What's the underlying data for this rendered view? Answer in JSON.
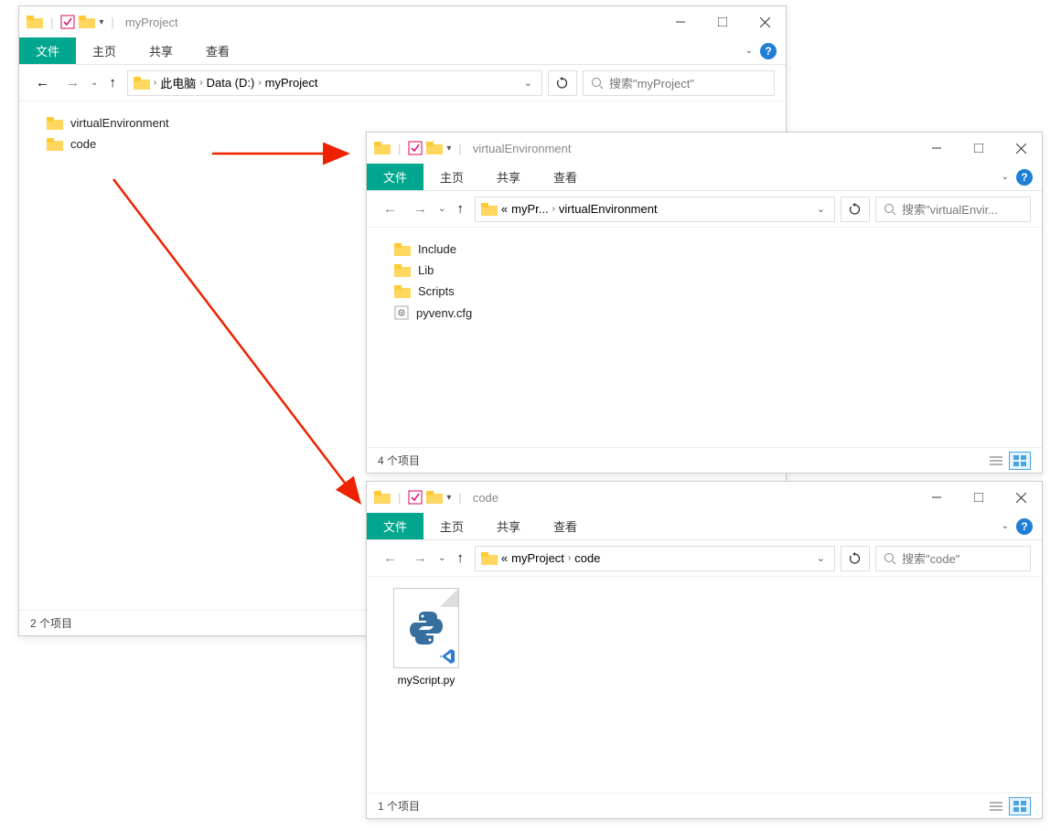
{
  "colors": {
    "accent": "#00a78e",
    "help": "#1e7fd6"
  },
  "ribbon": {
    "file": "文件",
    "home": "主页",
    "share": "共享",
    "view": "查看"
  },
  "window1": {
    "title": "myProject",
    "breadcrumb": [
      "此电脑",
      "Data (D:)",
      "myProject"
    ],
    "searchPlaceholder": "搜索\"myProject\"",
    "items": [
      {
        "name": "virtualEnvironment",
        "type": "folder"
      },
      {
        "name": "code",
        "type": "folder"
      }
    ],
    "status": "2 个项目"
  },
  "window2": {
    "title": "virtualEnvironment",
    "breadcrumbPrefix": "«",
    "breadcrumb": [
      "myPr...",
      "virtualEnvironment"
    ],
    "searchPlaceholder": "搜索\"virtualEnvir...",
    "items": [
      {
        "name": "Include",
        "type": "folder"
      },
      {
        "name": "Lib",
        "type": "folder"
      },
      {
        "name": "Scripts",
        "type": "folder"
      },
      {
        "name": "pyvenv.cfg",
        "type": "file"
      }
    ],
    "status": "4 个项目"
  },
  "window3": {
    "title": "code",
    "breadcrumbPrefix": "«",
    "breadcrumb": [
      "myProject",
      "code"
    ],
    "searchPlaceholder": "搜索\"code\"",
    "items": [
      {
        "name": "myScript.py",
        "type": "pyfile"
      }
    ],
    "status": "1 个项目"
  }
}
